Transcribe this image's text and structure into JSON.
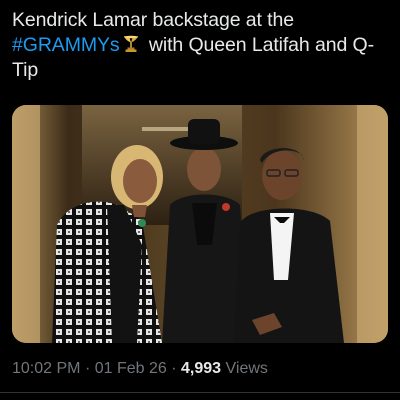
{
  "tweet": {
    "text_part1": "Kendrick Lamar backstage at the",
    "hashtag": "#GRAMMYs",
    "emoji_icon": "grammy-gramophone-icon",
    "text_part2": " with Queen Latifah and Q-Tip",
    "time": "10:02 PM",
    "separator": "·",
    "date": "01 Feb 26",
    "views_count": "4,993",
    "views_label": "Views"
  },
  "colors": {
    "background": "#000000",
    "text": "#e7e9ea",
    "hashtag": "#1d9bf0",
    "meta": "#71767b",
    "divider": "#2f3336"
  }
}
